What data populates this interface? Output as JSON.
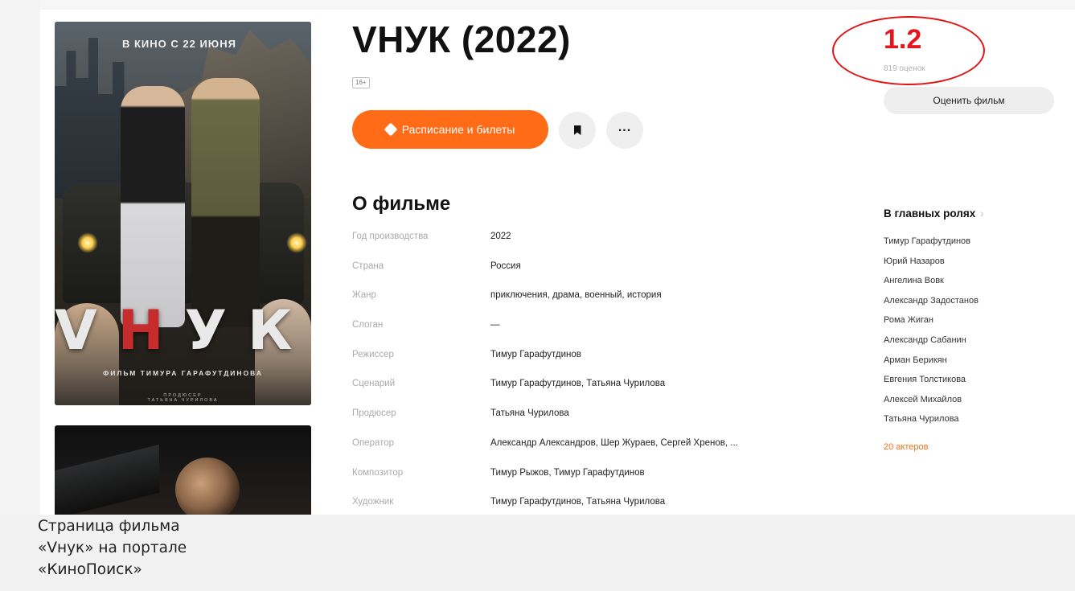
{
  "poster": {
    "tagline": "В КИНО С 22 ИЮНЯ",
    "title_part1": "V",
    "title_part2": "Н",
    "title_part3": "УК",
    "byline": "ФИЛЬМ ТИМУРА ГАРАФУТДИНОВА",
    "producer_label": "ПРОДЮСЕР",
    "producer_name": "ТАТЬЯНА ЧУРИЛОВА"
  },
  "film": {
    "title": "VНУК (2022)",
    "age_rating": "16+"
  },
  "actions": {
    "schedule_label": "Расписание и билеты",
    "bookmark_icon": "bookmark-icon",
    "more_icon": "more-icon",
    "more_glyph": "..."
  },
  "rating": {
    "value": "1.2",
    "votes": "819 оценок",
    "rate_button": "Оценить фильм",
    "accent_color": "#e8141b"
  },
  "about": {
    "heading": "О фильме",
    "rows": [
      {
        "key": "Год производства",
        "value": "2022"
      },
      {
        "key": "Страна",
        "value": "Россия"
      },
      {
        "key": "Жанр",
        "value": "приключения, драма, военный, история"
      },
      {
        "key": "Слоган",
        "value": "—"
      },
      {
        "key": "Режиссер",
        "value": "Тимур Гарафутдинов"
      },
      {
        "key": "Сценарий",
        "value": "Тимур Гарафутдинов, Татьяна Чурилова"
      },
      {
        "key": "Продюсер",
        "value": "Татьяна Чурилова"
      },
      {
        "key": "Оператор",
        "value": "Александр Александров, Шер Жураев, Сергей Хренов, ..."
      },
      {
        "key": "Композитор",
        "value": "Тимур Рыжов, Тимур Гарафутдинов"
      },
      {
        "key": "Художник",
        "value": "Тимур Гарафутдинов, Татьяна Чурилова"
      }
    ]
  },
  "cast": {
    "heading": "В главных ролях",
    "chevron": "›",
    "members": [
      "Тимур Гарафутдинов",
      "Юрий Назаров",
      "Ангелина Вовк",
      "Александр Задостанов",
      "Рома Жиган",
      "Александр Сабанин",
      "Арман Берикян",
      "Евгения Толстикова",
      "Алексей Михайлов",
      "Татьяна Чурилова"
    ],
    "more_link": "20 актеров",
    "link_color": "#ff6b16"
  },
  "caption": "Страница фильма\n«Vнук» на портале\n«КиноПоиск»"
}
